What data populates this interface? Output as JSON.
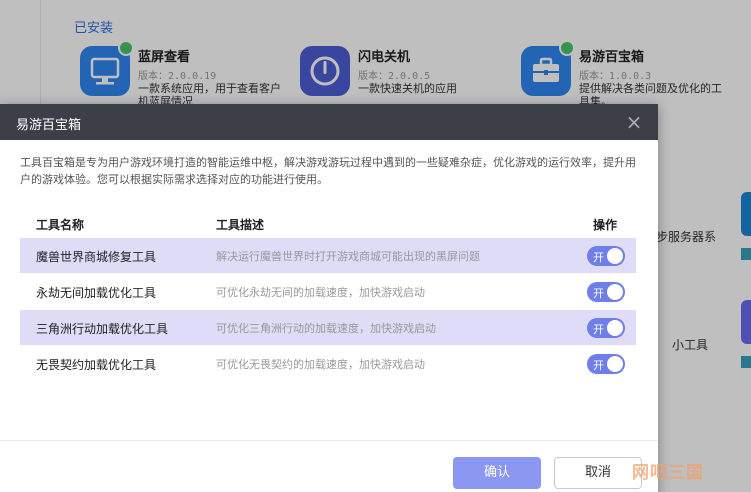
{
  "background": {
    "section_title": "已安装",
    "apps": [
      {
        "name": "蓝屏查看",
        "version": "版本：2.0.0.19",
        "desc": "一款系统应用，用于查看客户机蓝屏情况",
        "icon": "monitor-icon",
        "color": "#2f86f2"
      },
      {
        "name": "闪电关机",
        "version": "版本：2.0.0.5",
        "desc": "一款快速关机的应用",
        "icon": "power-icon",
        "color": "#4d5ed6"
      },
      {
        "name": "易游百宝箱",
        "version": "版本：1.0.0.3",
        "desc": "提供解决各类问题及优化的工具集。",
        "icon": "toolbox-icon",
        "color": "#2f86f2"
      }
    ],
    "side_texts": [
      "步服务器系",
      "小工具"
    ]
  },
  "modal": {
    "title": "易游百宝箱",
    "intro": "工具百宝箱是专为用户游戏环境打造的智能运维中枢，解决游戏游玩过程中遇到的一些疑难杂症，优化游戏的运行效率，提升用户的游戏体验。您可以根据实际需求选择对应的功能进行使用。",
    "columns": {
      "name": "工具名称",
      "desc": "工具描述",
      "action": "操作"
    },
    "rows": [
      {
        "name": "魔兽世界商城修复工具",
        "desc": "解决运行魔兽世界时打开游戏商城可能出现的黑屏问题",
        "toggle": "开"
      },
      {
        "name": "永劫无间加载优化工具",
        "desc": "可优化永劫无间的加载速度，加快游戏启动",
        "toggle": "开"
      },
      {
        "name": "三角洲行动加载优化工具",
        "desc": "可优化三角洲行动的加载速度，加快游戏启动",
        "toggle": "开"
      },
      {
        "name": "无畏契约加载优化工具",
        "desc": "可优化无畏契约的加载速度，加快游戏启动",
        "toggle": "开"
      }
    ],
    "ok_label": "确认",
    "cancel_label": "取消"
  },
  "watermark": "网吧三国",
  "colors": {
    "header": "#3c3f48",
    "accent": "#6e7fe8",
    "row_shade": "#dedcf7",
    "link": "#2f6fe0"
  }
}
